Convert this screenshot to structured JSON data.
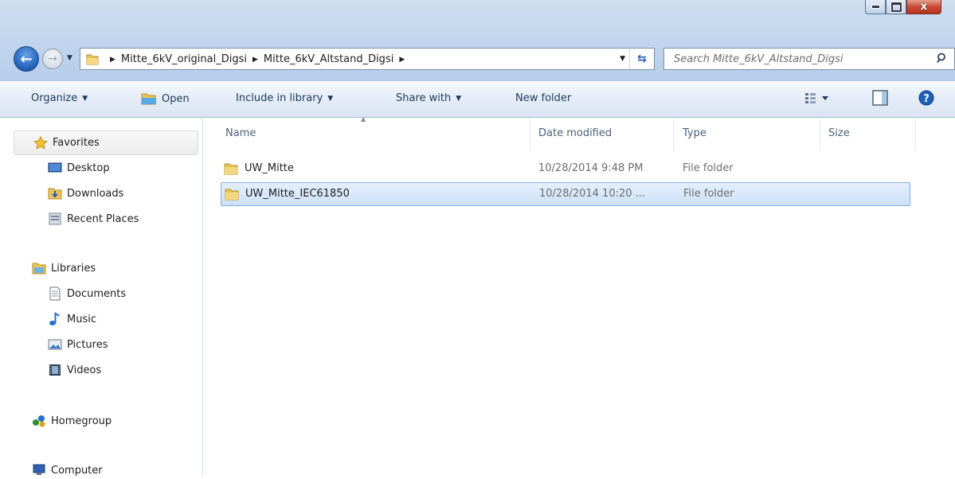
{
  "window": {
    "minimize_label": "",
    "maximize_label": "",
    "close_label": "x"
  },
  "nav": {
    "breadcrumbs": [
      "Mitte_6kV_original_Digsi",
      "Mitte_6kV_Altstand_Digsi"
    ],
    "search_placeholder": "Search Mitte_6kV_Altstand_Digsi"
  },
  "toolbar": {
    "organize": "Organize",
    "open": "Open",
    "include_in_library": "Include in library",
    "share_with": "Share with",
    "new_folder": "New folder"
  },
  "sidebar": {
    "favorites": "Favorites",
    "desktop": "Desktop",
    "downloads": "Downloads",
    "recent_places": "Recent Places",
    "libraries": "Libraries",
    "documents": "Documents",
    "music": "Music",
    "pictures": "Pictures",
    "videos": "Videos",
    "homegroup": "Homegroup",
    "computer": "Computer"
  },
  "columns": {
    "name": "Name",
    "date_modified": "Date modified",
    "type": "Type",
    "size": "Size"
  },
  "files": [
    {
      "name": "UW_Mitte",
      "date": "10/28/2014 9:48 PM",
      "type": "File folder",
      "size": "",
      "selected": false
    },
    {
      "name": "UW_Mitte_IEC61850",
      "date": "10/28/2014 10:20 ...",
      "type": "File folder",
      "size": "",
      "selected": true
    }
  ],
  "colors": {
    "selection_bg": "#cde1f7",
    "selection_border": "#84acdd",
    "toolbar_text": "#1e395b"
  }
}
